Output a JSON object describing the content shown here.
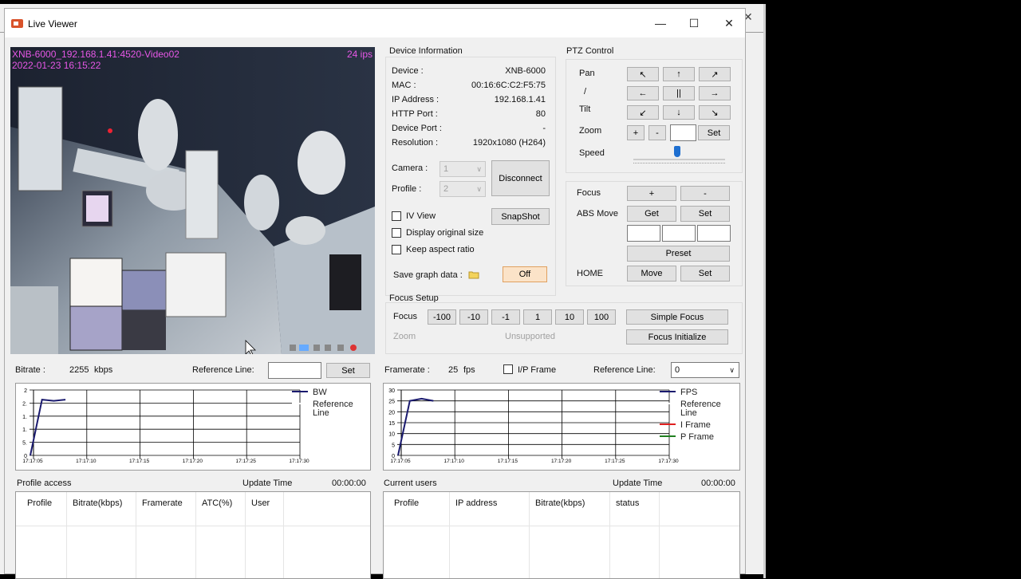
{
  "window": {
    "title": "Live Viewer",
    "minimize": "—",
    "maximize": "☐",
    "close": "✕",
    "bg_close": "✕"
  },
  "video": {
    "camera_label": "XNB-6000_192.168.1.41:4520-Video02",
    "timestamp": "2022-01-23 16:15:22",
    "fps_label": "24 ips"
  },
  "device_info": {
    "title": "Device Information",
    "rows": [
      {
        "label": "Device :",
        "value": "XNB-6000"
      },
      {
        "label": "MAC :",
        "value": "00:16:6C:C2:F5:75"
      },
      {
        "label": "IP Address :",
        "value": "192.168.1.41"
      },
      {
        "label": "HTTP Port :",
        "value": "80"
      },
      {
        "label": "Device Port :",
        "value": "-"
      },
      {
        "label": "Resolution :",
        "value": "1920x1080 (H264)"
      }
    ],
    "camera_label": "Camera :",
    "camera_value": "1",
    "profile_label": "Profile :",
    "profile_value": "2",
    "disconnect": "Disconnect",
    "iv_view": "IV View",
    "snapshot": "SnapShot",
    "display_original": "Display original size",
    "keep_aspect": "Keep aspect ratio",
    "save_graph": "Save graph data :",
    "save_toggle": "Off"
  },
  "ptz": {
    "title": "PTZ Control",
    "pan": "Pan",
    "slash": "/",
    "tilt": "Tilt",
    "zoom": "Zoom",
    "speed": "Speed",
    "arrows": [
      "↖",
      "↑",
      "↗",
      "←",
      "||",
      "→",
      "↙",
      "↓",
      "↘"
    ],
    "zoom_plus": "+",
    "zoom_minus": "-",
    "zoom_set": "Set",
    "speed_level": 0.48,
    "focus": "Focus",
    "focus_plus": "+",
    "focus_minus": "-",
    "abs_move": "ABS Move",
    "abs_get": "Get",
    "abs_set": "Set",
    "preset": "Preset",
    "home": "HOME",
    "home_move": "Move",
    "home_set": "Set"
  },
  "focus_setup": {
    "title": "Focus Setup",
    "focus": "Focus",
    "steps": [
      "-100",
      "-10",
      "-1",
      "1",
      "10",
      "100"
    ],
    "simple_focus": "Simple Focus",
    "zoom": "Zoom",
    "unsupported": "Unsupported",
    "focus_init": "Focus Initialize"
  },
  "bitrate": {
    "label": "Bitrate :",
    "value": "2255",
    "unit": "kbps",
    "ref_label": "Reference Line:",
    "set": "Set"
  },
  "framerate": {
    "label": "Framerate :",
    "value": "25",
    "unit": "fps",
    "ip_frame": "I/P Frame",
    "ref_label": "Reference Line:",
    "ref_value": "0"
  },
  "chart_data": [
    {
      "type": "line",
      "title": "",
      "y_ticks": [
        "2",
        "2.",
        "1.",
        "1.",
        "5.",
        "0"
      ],
      "x_ticks": [
        "17:17:05",
        "17:17:10",
        "17:17:15",
        "17:17:20",
        "17:17:25",
        "17:17:30"
      ],
      "legend": [
        "BW",
        "Reference Line"
      ],
      "series": [
        {
          "name": "BW",
          "color": "#1a1a6e",
          "x": [
            "17:17:05",
            "17:17:06",
            "17:17:07",
            "17:17:08"
          ],
          "y": [
            0,
            2.3,
            2.25,
            2.3
          ]
        }
      ],
      "ylim": [
        0,
        2.7
      ]
    },
    {
      "type": "line",
      "title": "",
      "y_ticks": [
        "30",
        "25",
        "20",
        "15",
        "10",
        "5",
        "0"
      ],
      "x_ticks": [
        "17:17:05",
        "17:17:10",
        "17:17:15",
        "17:17:20",
        "17:17:25",
        "17:17:30"
      ],
      "legend": [
        "FPS",
        "Reference Line",
        "I Frame",
        "P Frame"
      ],
      "legend_colors": [
        "#1a1a6e",
        "#ffffff",
        "#e02020",
        "#208020"
      ],
      "series": [
        {
          "name": "FPS",
          "color": "#1a1a6e",
          "x": [
            "17:17:05",
            "17:17:06",
            "17:17:07",
            "17:17:08"
          ],
          "y": [
            0,
            25,
            26,
            25
          ]
        }
      ],
      "ylim": [
        0,
        30
      ]
    }
  ],
  "profile_access": {
    "title": "Profile access",
    "update_label": "Update Time",
    "update_time": "00:00:00",
    "columns": [
      "Profile",
      "Bitrate(kbps)",
      "Framerate",
      "ATC(%)",
      "User"
    ]
  },
  "current_users": {
    "title": "Current users",
    "update_label": "Update Time",
    "update_time": "00:00:00",
    "columns": [
      "Profile",
      "IP address",
      "Bitrate(kbps)",
      "status"
    ]
  }
}
